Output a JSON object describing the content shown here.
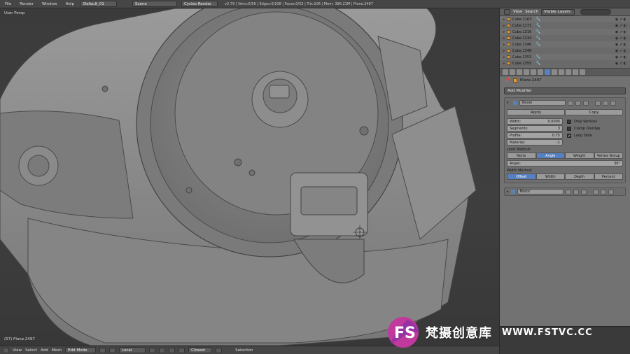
{
  "topbar": {
    "menus": [
      "File",
      "Render",
      "Window",
      "Help"
    ],
    "layout": "Default_01",
    "scene": "Scene",
    "engine": "Cycles Render",
    "stats": "v2.79 | Verts:0/56 | Edges:0/108 | Faces:0/53 | Tris:106 | Mem: 396.21M | Plane.2497"
  },
  "viewport": {
    "view_label": "User Persp",
    "object_label": "(57) Plane.2497"
  },
  "bottombar": {
    "menus": [
      "View",
      "Select",
      "Add",
      "Mesh"
    ],
    "mode": "Edit Mode",
    "pivot": "Local",
    "snap": "Closest",
    "selection": "Selection"
  },
  "outliner": {
    "header": {
      "view": "View",
      "search": "Search",
      "filter": "Visible Layers"
    },
    "items": [
      {
        "name": "Cube.1163",
        "mod": true
      },
      {
        "name": "Cube.1171",
        "mod": true
      },
      {
        "name": "Cube.1316",
        "mod": true
      },
      {
        "name": "Cube.1234",
        "mod": true
      },
      {
        "name": "Cube.1346",
        "mod": true
      },
      {
        "name": "Cube.1348",
        "mod": false
      },
      {
        "name": "Cube.1353",
        "mod": true
      },
      {
        "name": "Cube.1355",
        "mod": true
      }
    ]
  },
  "properties": {
    "object_name": "Plane.2497",
    "add_modifier": "Add Modifier",
    "bevel": {
      "name": "Bevel",
      "apply": "Apply",
      "copy": "Copy",
      "width_label": "Width:",
      "width_value": "0.0005",
      "segments_label": "Segments:",
      "segments_value": "3",
      "profile_label": "Profile:",
      "profile_value": "0.75",
      "material_label": "Material:",
      "material_value": "-1",
      "only_vertices": "Only Vertices",
      "clamp_overlap": "Clamp Overlap",
      "loop_slide": "Loop Slide",
      "limit_method_label": "Limit Method:",
      "limit_methods": [
        "None",
        "Angle",
        "Weight",
        "Vertex Group"
      ],
      "limit_active": "Angle",
      "angle_label": "Angle:",
      "angle_value": "30°",
      "width_method_label": "Width Method:",
      "width_methods": [
        "Offset",
        "Width",
        "Depth",
        "Percent"
      ],
      "width_method_active": "Offset"
    },
    "mirror": {
      "name": "Mirror"
    }
  },
  "watermark": {
    "logo_text": "FS",
    "text": "梵摄创意库",
    "url": "WWW.FSTVC.CC"
  }
}
